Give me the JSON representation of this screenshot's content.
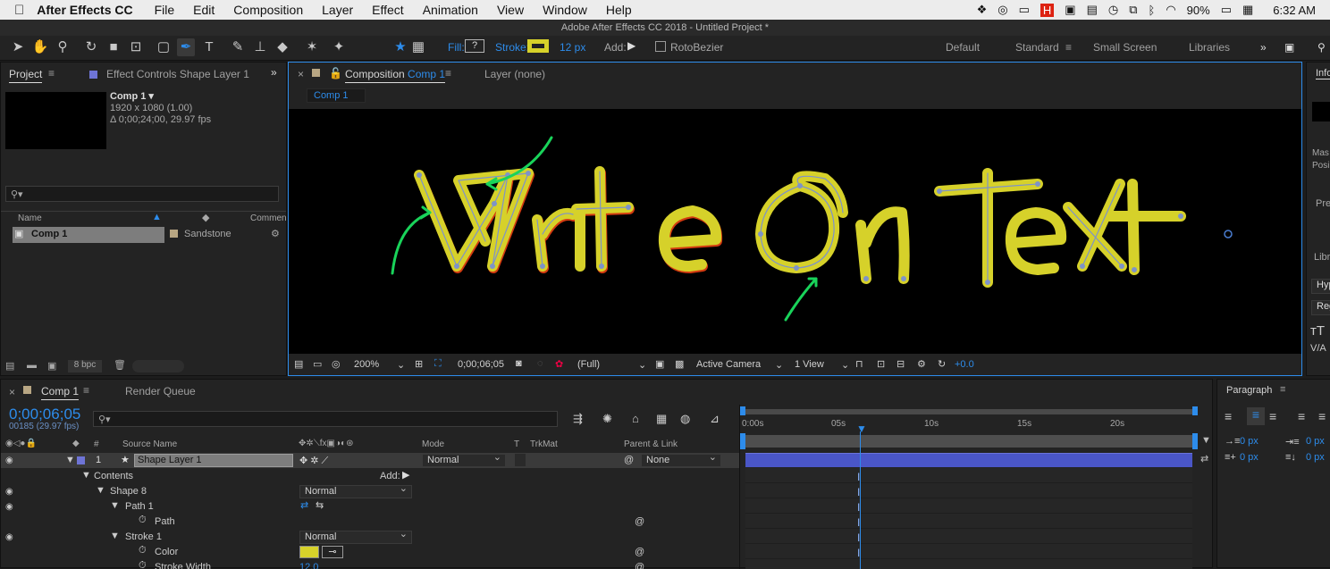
{
  "menubar": {
    "app": "After Effects CC",
    "items": [
      "File",
      "Edit",
      "Composition",
      "Layer",
      "Effect",
      "Animation",
      "View",
      "Window",
      "Help"
    ],
    "battery": "90%",
    "time": "6:32 AM"
  },
  "window_title": "Adobe After Effects CC 2018 - Untitled Project *",
  "toolbar": {
    "fill_label": "Fill:",
    "stroke_label": "Stroke:",
    "stroke_width": "12 px",
    "add_label": "Add:",
    "rotobezier": "RotoBezier",
    "stroke_color": "#d6d12a"
  },
  "workspaces": [
    "Default",
    "Standard",
    "Small Screen",
    "Libraries"
  ],
  "project": {
    "tab": "Project",
    "effect_tab": "Effect Controls Shape Layer 1",
    "comp_name": "Comp 1 ▾",
    "comp_res": "1920 x 1080 (1.00)",
    "comp_dur": "Δ 0;00;24;00, 29.97 fps",
    "col_name": "Name",
    "col_comment": "Commen",
    "item_name": "Comp 1",
    "item_label": "Sandstone",
    "bpc": "8 bpc"
  },
  "comp": {
    "tab_prefix": "Composition",
    "tab_name": "Comp 1",
    "layer_tab": "Layer (none)",
    "crumb": "Comp 1",
    "zoom": "200%",
    "time": "0;00;06;05",
    "resolution": "(Full)",
    "camera": "Active Camera",
    "views": "1 View",
    "exposure": "+0.0",
    "canvas_text": "Write On Text"
  },
  "info": {
    "tab": "Info",
    "mask": "Mas",
    "pos": "Posi",
    "pre": "Pre",
    "libr": "Libr",
    "hyp": "Hyp",
    "reg": "Reg"
  },
  "timeline": {
    "tab": "Comp 1",
    "render_tab": "Render Queue",
    "timecode": "0;00;06;05",
    "frames": "00185 (29.97 fps)",
    "col_source": "Source Name",
    "col_mode": "Mode",
    "col_t": "T",
    "col_trkmat": "TrkMat",
    "col_parent": "Parent & Link",
    "layer_num": "1",
    "layer_name": "Shape Layer 1",
    "layer_mode": "Normal",
    "layer_parent": "None",
    "contents": "Contents",
    "add": "Add:",
    "shape8": "Shape 8",
    "shape8_mode": "Normal",
    "path1": "Path 1",
    "path": "Path",
    "stroke1": "Stroke 1",
    "stroke1_mode": "Normal",
    "color": "Color",
    "stroke_width_label": "Stroke Width",
    "stroke_width_value": "12.0",
    "ruler": [
      "0:00s",
      "05s",
      "10s",
      "15s",
      "20s"
    ]
  },
  "paragraph": {
    "tab": "Paragraph",
    "v1": "0 px",
    "v2": "0 px",
    "v3": "0 px",
    "v4": "0 px"
  }
}
